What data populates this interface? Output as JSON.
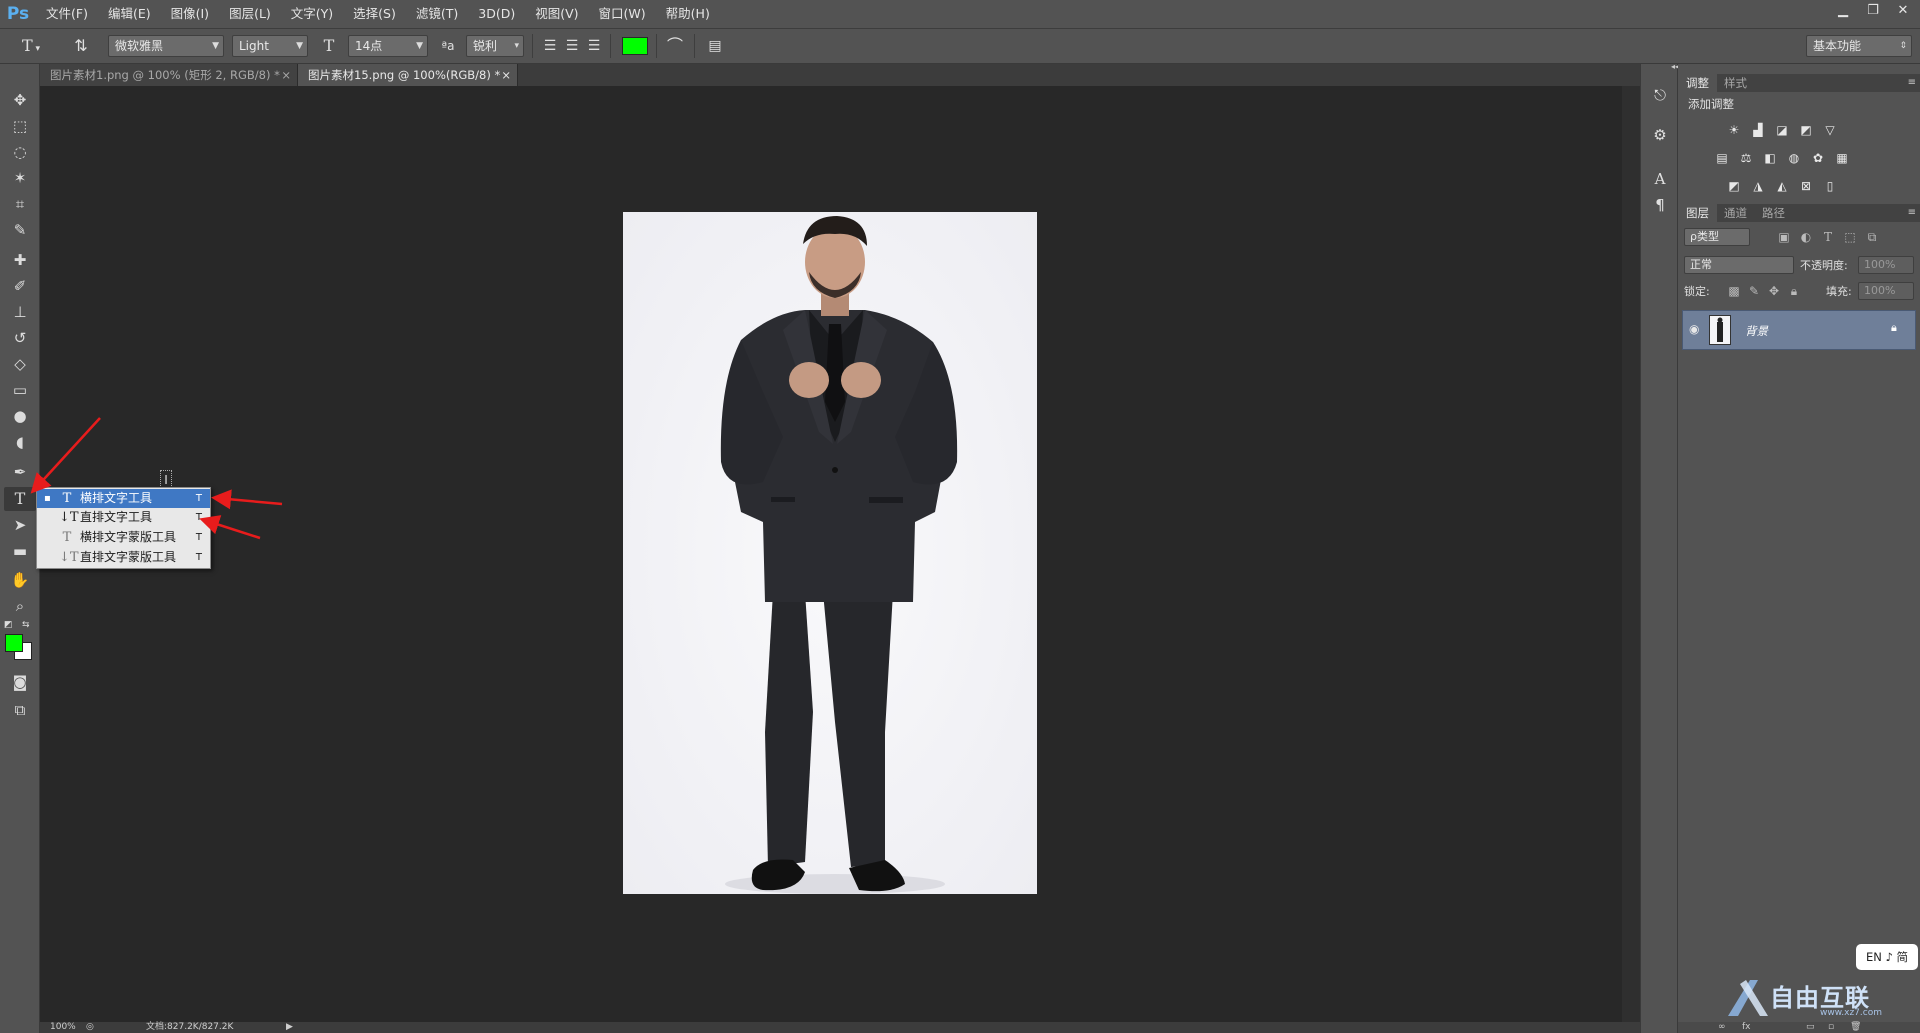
{
  "app": {
    "logo": "Ps",
    "menu": [
      "文件(F)",
      "编辑(E)",
      "图像(I)",
      "图层(L)",
      "文字(Y)",
      "选择(S)",
      "滤镜(T)",
      "3D(D)",
      "视图(V)",
      "窗口(W)",
      "帮助(H)"
    ],
    "window_buttons": [
      "minimize-icon",
      "restore-icon",
      "close-icon"
    ]
  },
  "options": {
    "font_family": "微软雅黑",
    "font_style": "Light",
    "font_size": "14点",
    "aa_label": "ªa",
    "antialias": "锐利",
    "text_color": "#00ff00",
    "workspace": "基本功能"
  },
  "tabs": [
    {
      "label": "图片素材1.png @ 100% (矩形 2, RGB/8) *",
      "close": "×"
    },
    {
      "label": "图片素材15.png @ 100%(RGB/8) *",
      "close": "×"
    }
  ],
  "flyout": {
    "items": [
      {
        "label": "横排文字工具",
        "key": "T",
        "icon": "T",
        "selected": true
      },
      {
        "label": "直排文字工具",
        "key": "T",
        "icon": "↓T",
        "selected": false
      },
      {
        "label": "横排文字蒙版工具",
        "key": "T",
        "icon": "T",
        "selected": false
      },
      {
        "label": "直排文字蒙版工具",
        "key": "T",
        "icon": "↓T",
        "selected": false
      }
    ],
    "bullet": "▪"
  },
  "status": {
    "zoom": "100%",
    "doc_info": "文档:827.2K/827.2K"
  },
  "colors": {
    "foreground": "#00ff00",
    "background": "#ffffff",
    "accent": "#3f78c4",
    "arrow": "#e81c1c"
  },
  "panels": {
    "adjust_tabs": [
      "调整",
      "样式"
    ],
    "adjust_title": "添加调整",
    "layer_tabs": [
      "图层",
      "通道",
      "路径"
    ],
    "filter_label": "ρ类型",
    "blend_mode": "正常",
    "opacity_label": "不透明度:",
    "opacity_value": "100%",
    "lock_label": "锁定:",
    "fill_label": "填充:",
    "fill_value": "100%",
    "layer_name": "背景"
  },
  "ime": {
    "text": "EN ♪ 简"
  },
  "watermark": {
    "text": "自由互联",
    "sub": "www.xz7.com"
  }
}
